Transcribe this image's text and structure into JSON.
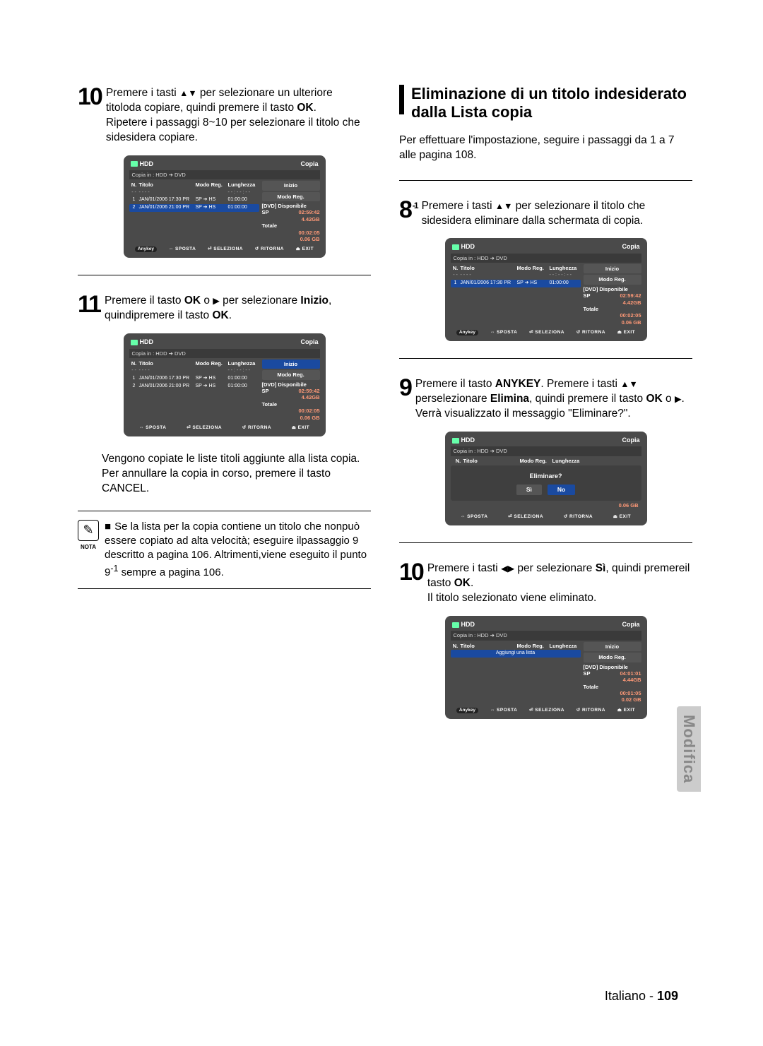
{
  "footer": {
    "lang": "Italiano",
    "page": "109"
  },
  "side_tab": "Modifica",
  "left": {
    "step10": {
      "num": "10",
      "text_a": "Premere i tasti ",
      "text_b": " per selezionare un ulteriore titoloda copiare, quindi premere il tasto ",
      "ok": "OK",
      "text_c": ".",
      "line2": "Ripetere i passaggi 8~10 per selezionare il titolo che sidesidera copiare."
    },
    "screen1": {
      "hdd": "HDD",
      "copia": "Copia",
      "sub": "Copia in : HDD ➔ DVD",
      "cols": {
        "n": "N.",
        "t": "Titolo",
        "m": "Modo Reg.",
        "l": "Lunghezza"
      },
      "rows": [
        {
          "n": "1",
          "t": "JAN/01/2006 17:30 PR",
          "m": "SP ➔ HS",
          "l": "01:00:00",
          "hi": false
        },
        {
          "n": "2",
          "t": "JAN/01/2006 21:00 PR",
          "m": "SP ➔ HS",
          "l": "01:00:00",
          "hi": true
        }
      ],
      "right": {
        "inizio": "Inizio",
        "modoreg": "Modo Reg.",
        "disp_lbl": "[DVD] Disponibile",
        "disp_sp": "SP",
        "disp_time": "02:59:42",
        "disp_gb": "4.42GB",
        "tot_lbl": "Totale",
        "tot_time": "00:02:05",
        "tot_gb": "0.06 GB"
      },
      "foot": {
        "anykey": "Anykey",
        "sposta": "SPOSTA",
        "seleziona": "SELEZIONA",
        "ritorna": "RITORNA",
        "exit": "EXIT"
      }
    },
    "step11": {
      "num": "11",
      "text_a": "Premere il tasto ",
      "ok": "OK",
      "text_b": " o ",
      "text_c": " per selezionare ",
      "inizio": "Inizio",
      "text_d": ", quindipremere il tasto ",
      "text_e": "."
    },
    "screen2": {
      "hdd": "HDD",
      "copia": "Copia",
      "sub": "Copia in : HDD ➔ DVD",
      "cols": {
        "n": "N.",
        "t": "Titolo",
        "m": "Modo Reg.",
        "l": "Lunghezza"
      },
      "rows": [
        {
          "n": "1",
          "t": "JAN/01/2006 17:30 PR",
          "m": "SP ➔ HS",
          "l": "01:00:00"
        },
        {
          "n": "2",
          "t": "JAN/01/2006 21:00 PR",
          "m": "SP ➔ HS",
          "l": "01:00:00"
        }
      ],
      "right": {
        "inizio": "Inizio",
        "modoreg": "Modo Reg.",
        "disp_lbl": "[DVD] Disponibile",
        "disp_sp": "SP",
        "disp_time": "02:59:42",
        "disp_gb": "4.42GB",
        "tot_lbl": "Totale",
        "tot_time": "00:02:05",
        "tot_gb": "0.06 GB"
      },
      "foot": {
        "sposta": "SPOSTA",
        "seleziona": "SELEZIONA",
        "ritorna": "RITORNA",
        "exit": "EXIT"
      }
    },
    "after11": "Vengono copiate le liste titoli aggiunte alla lista copia. Per annullare la copia in corso, premere il tasto ",
    "cancel": "CANCEL",
    "note": {
      "label": "NOTA",
      "text": "Se la lista per la copia contiene un titolo che nonpuò essere copiato ad alta velocità; eseguire ilpassaggio 9 descritto a pagina 106. Altrimenti,viene eseguito il punto 9",
      "sup": "-1",
      "tail": " sempre a pagina 106."
    }
  },
  "right": {
    "heading": "Eliminazione di un titolo indesiderato dalla Lista copia",
    "intro": "Per effettuare l'impostazione, seguire i passaggi da 1 a 7 alle pagina 108.",
    "step8": {
      "num": "8",
      "sup": "-1",
      "text_a": "Premere i tasti ",
      "text_b": " per selezionare il titolo che sidesidera eliminare dalla schermata di copia."
    },
    "screen3": {
      "hdd": "HDD",
      "copia": "Copia",
      "sub": "Copia in : HDD ➔ DVD",
      "cols": {
        "n": "N.",
        "t": "Titolo",
        "m": "Modo Reg.",
        "l": "Lunghezza"
      },
      "rows": [
        {
          "n": "1",
          "t": "JAN/01/2006 17:30 PR",
          "m": "SP ➔ HS",
          "l": "01:00:00",
          "hi": true
        }
      ],
      "right": {
        "inizio": "Inizio",
        "modoreg": "Modo Reg.",
        "disp_lbl": "[DVD] Disponibile",
        "disp_sp": "SP",
        "disp_time": "02:59:42",
        "disp_gb": "4.42GB",
        "tot_lbl": "Totale",
        "tot_time": "00:02:05",
        "tot_gb": "0.06 GB"
      },
      "foot": {
        "anykey": "Anykey",
        "sposta": "SPOSTA",
        "seleziona": "SELEZIONA",
        "ritorna": "RITORNA",
        "exit": "EXIT"
      }
    },
    "step9": {
      "num": "9",
      "text_a": "Premere il tasto ",
      "anykey": "ANYKEY",
      "text_b": ". Premere i tasti ",
      "text_c": " perselezionare ",
      "elimina": "Elimina",
      "text_d": ", quindi premere il tasto ",
      "ok": "OK",
      "text_e": " o ",
      "text_f": ". Verrà visualizzato il messaggio \"Eliminare?\"."
    },
    "screen4": {
      "hdd": "HDD",
      "copia": "Copia",
      "sub": "Copia in : HDD ➔ DVD",
      "cols": {
        "n": "N.",
        "t": "Titolo",
        "m": "Modo Reg.",
        "l": "Lunghezza"
      },
      "msg": "Eliminare?",
      "yes": "Sì",
      "no": "No",
      "gb": "0.06 GB",
      "foot": {
        "sposta": "SPOSTA",
        "seleziona": "SELEZIONA",
        "ritorna": "RITORNA",
        "exit": "EXIT"
      }
    },
    "step10r": {
      "num": "10",
      "text_a": "Premere i tasti ",
      "text_b": " per selezionare ",
      "si": "Sì",
      "text_c": ", quindi premereil tasto ",
      "ok": "OK",
      "text_d": ".",
      "line2": "Il titolo selezionato viene eliminato."
    },
    "screen5": {
      "hdd": "HDD",
      "copia": "Copia",
      "sub": "Copia in : HDD ➔ DVD",
      "cols": {
        "n": "N.",
        "t": "Titolo",
        "m": "Modo Reg.",
        "l": "Lunghezza"
      },
      "addrow": "Aggiungi una lista",
      "right": {
        "inizio": "Inizio",
        "modoreg": "Modo Reg.",
        "disp_lbl": "[DVD] Disponibile",
        "disp_sp": "SP",
        "disp_time": "04:01:01",
        "disp_gb": "4.44GB",
        "tot_lbl": "Totale",
        "tot_time": "00:01:05",
        "tot_gb": "0.02 GB"
      },
      "foot": {
        "anykey": "Anykey",
        "sposta": "SPOSTA",
        "seleziona": "SELEZIONA",
        "ritorna": "RITORNA",
        "exit": "EXIT"
      }
    }
  }
}
